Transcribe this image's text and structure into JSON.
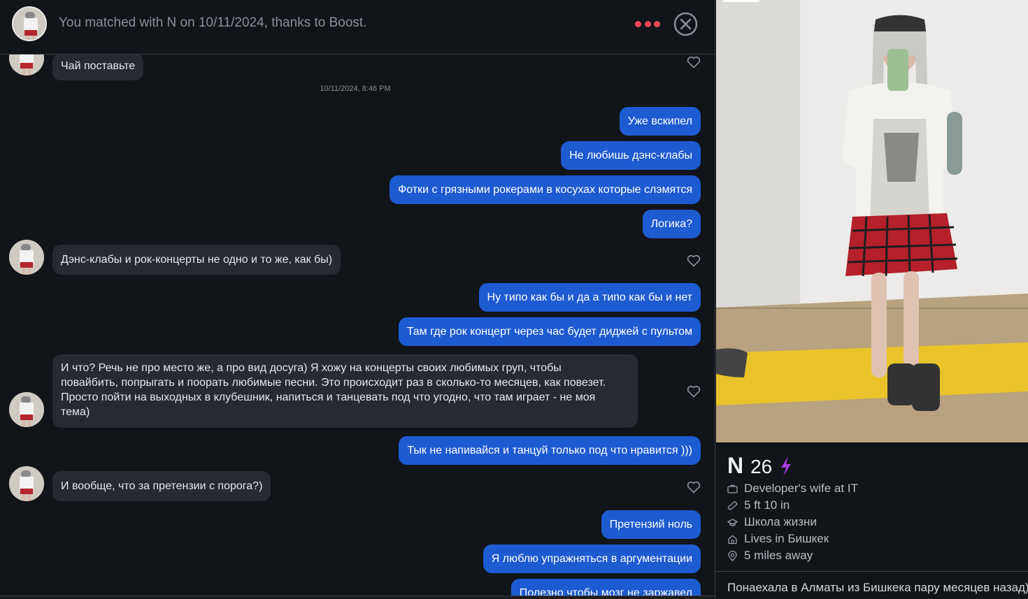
{
  "header": {
    "match_text": "You matched with N on 10/11/2024, thanks to Boost."
  },
  "chat": {
    "timestamp": "10/11/2024, 8:46 PM",
    "messages": [
      {
        "from": "them",
        "text": "Чай поставьте"
      },
      {
        "from": "me",
        "text": "Уже вскипел"
      },
      {
        "from": "me",
        "text": "Не любишь дэнс-клабы"
      },
      {
        "from": "me",
        "text": "Фотки с грязными рокерами в косухах которые слэмятся"
      },
      {
        "from": "me",
        "text": "Логика?"
      },
      {
        "from": "them",
        "text": "Дэнс-клабы и рок-концерты не одно и то же, как бы)"
      },
      {
        "from": "me",
        "text": "Ну типо как бы и да а типо как бы и нет"
      },
      {
        "from": "me",
        "text": "Там где рок концерт через час будет диджей с пультом"
      },
      {
        "from": "them",
        "lines": [
          "И что? Речь не про место же, а про вид досуга) Я хожу на концерты своих любимых груп, чтобы",
          "повайбить, попрыгать и поорать любимые песни. Это происходит раз в сколько-то месяцев, как повезет.",
          "Просто пойти на выходных в клубешник, напиться и танцевать под что угодно, что там играет - не моя",
          "тема)"
        ]
      },
      {
        "from": "me",
        "text": "Тык не напивайся и танцуй только под что нравится )))"
      },
      {
        "from": "them",
        "text": "И вообще, что за претензии с порога?)"
      },
      {
        "from": "me",
        "text": "Претензий ноль"
      },
      {
        "from": "me",
        "text": "Я люблю упражняться в аргументации"
      },
      {
        "from": "me",
        "text": "Полезно чтобы мозг не заржавел"
      }
    ]
  },
  "profile": {
    "name": "N",
    "age": "26",
    "job": "Developer's wife at IT",
    "height": "5 ft 10 in",
    "school": "Школа жизни",
    "lives": "Lives in Бишкек",
    "distance": "5 miles away",
    "bio": "Понаехала в Алматы из Бишкека пару месяцев назад)"
  },
  "colors": {
    "background": "#111418",
    "incoming_bubble": "#262a31",
    "outgoing_bubble": "#1d5bd1",
    "accent_red": "#f0465a",
    "boost_purple": "#a63bd9"
  },
  "icons": [
    "more-icon",
    "close-icon",
    "heart-icon",
    "boost-icon",
    "briefcase-icon",
    "ruler-icon",
    "graduation-cap-icon",
    "home-icon",
    "location-pin-icon"
  ]
}
